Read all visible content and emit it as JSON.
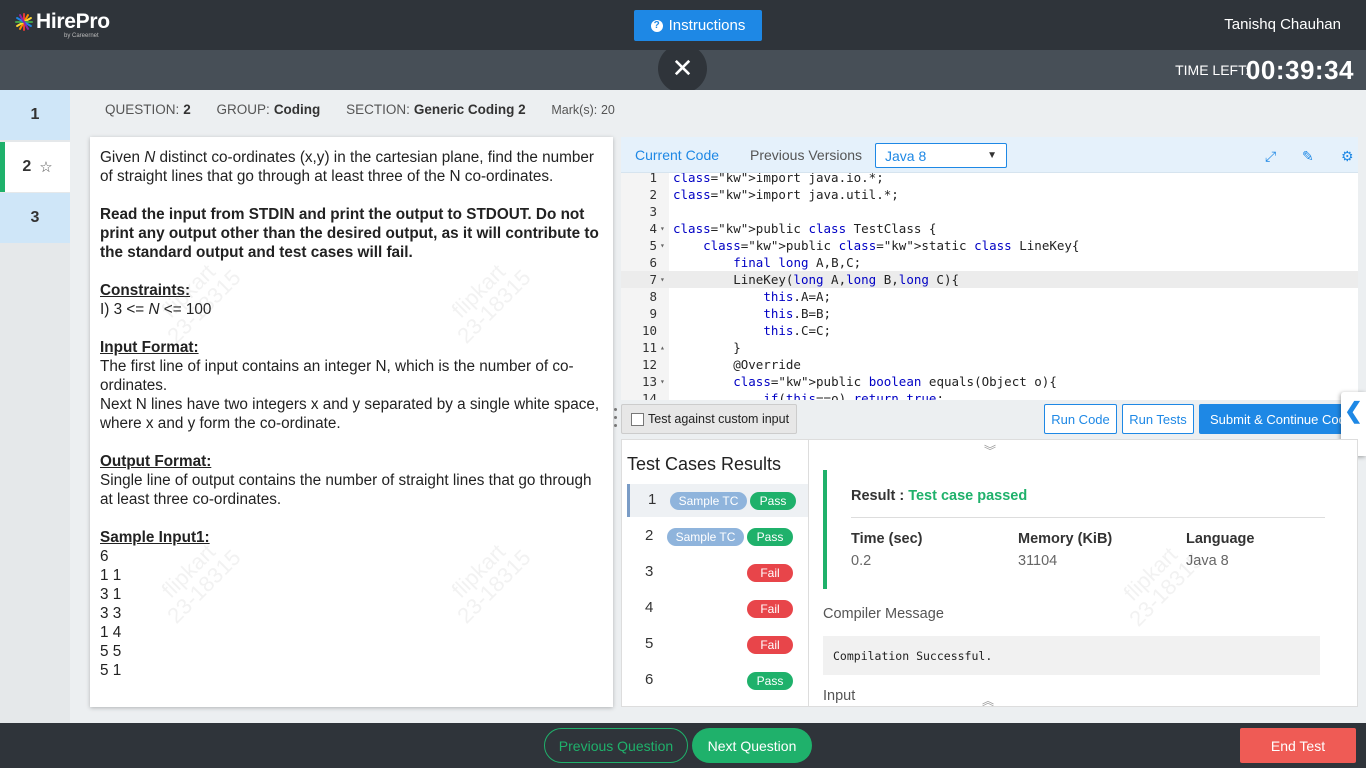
{
  "header": {
    "logo_text": "HirePro",
    "logo_sub": "by Careernet",
    "instructions_label": "Instructions",
    "user_name": "Tanishq Chauhan",
    "time_left_label": "TIME LEFT:",
    "time_left_value": "00:39:34"
  },
  "question_nav": [
    {
      "num": "1"
    },
    {
      "num": "2"
    },
    {
      "num": "3"
    }
  ],
  "meta": {
    "question_label": "QUESTION:",
    "question_value": "2",
    "group_label": "GROUP:",
    "group_value": "Coding",
    "section_label": "SECTION:",
    "section_value": "Generic Coding 2",
    "marks_label": "Mark(s):",
    "marks_value": "20"
  },
  "problem": {
    "intro_a": "Given ",
    "intro_n": "N",
    "intro_b": " distinct co-ordinates (x,y) in the cartesian plane, find the number of straight lines that go through at least three of the N co-ordinates.",
    "stdin_note": "Read the input from STDIN and print the output to STDOUT. Do not print any output other than the desired output, as it will contribute to the standard output and test cases will fail.",
    "constraints_heading": "Constraints:",
    "constraint_a": "I) 3 <= ",
    "constraint_n": "N",
    "constraint_b": " <= 100",
    "input_heading": "Input Format:",
    "input_line1": "The first line of input contains an integer N, which is the number of co-ordinates.",
    "input_line2": "Next N lines have two integers x and y separated by a single white space, where x and y form the co-ordinate.",
    "output_heading": "Output Format:",
    "output_line1": "Single line of output contains the number of straight lines that go through at least three co-ordinates.",
    "sample_heading": "Sample Input1:",
    "sample_lines": [
      "6",
      "1 1",
      "3 1",
      "3 3",
      "1 4",
      "5 5",
      "5 1"
    ]
  },
  "editor": {
    "tab_current": "Current Code",
    "tab_previous": "Previous Versions",
    "language": "Java 8",
    "code_lines": [
      {
        "n": "1",
        "fold": "",
        "text": "import java.io.*;"
      },
      {
        "n": "2",
        "fold": "",
        "text": "import java.util.*;"
      },
      {
        "n": "3",
        "fold": "",
        "text": ""
      },
      {
        "n": "4",
        "fold": "▾",
        "text": "public class TestClass {"
      },
      {
        "n": "5",
        "fold": "▾",
        "text": "    public static class LineKey{"
      },
      {
        "n": "6",
        "fold": "",
        "text": "        final long A,B,C;"
      },
      {
        "n": "7",
        "fold": "▾",
        "text": "        LineKey(long A,long B,long C){"
      },
      {
        "n": "8",
        "fold": "",
        "text": "            this.A=A;"
      },
      {
        "n": "9",
        "fold": "",
        "text": "            this.B=B;"
      },
      {
        "n": "10",
        "fold": "",
        "text": "            this.C=C;"
      },
      {
        "n": "11",
        "fold": "▴",
        "text": "        }"
      },
      {
        "n": "12",
        "fold": "",
        "text": "        @Override"
      },
      {
        "n": "13",
        "fold": "▾",
        "text": "        public boolean equals(Object o){"
      },
      {
        "n": "14",
        "fold": "",
        "text": "            if(this==o) return true;"
      }
    ]
  },
  "controls": {
    "custom_input_label": "Test against custom input",
    "run_code": "Run Code",
    "run_tests": "Run Tests",
    "submit": "Submit & Continue Coding"
  },
  "results": {
    "title": "Test Cases Results",
    "cases": [
      {
        "num": "1",
        "sample": "Sample TC",
        "status": "Pass"
      },
      {
        "num": "2",
        "sample": "Sample TC",
        "status": "Pass"
      },
      {
        "num": "3",
        "sample": "",
        "status": "Fail"
      },
      {
        "num": "4",
        "sample": "",
        "status": "Fail"
      },
      {
        "num": "5",
        "sample": "",
        "status": "Fail"
      },
      {
        "num": "6",
        "sample": "",
        "status": "Pass"
      }
    ],
    "result_label": "Result :",
    "result_value": "Test case passed",
    "time_label": "Time (sec)",
    "time_value": "0.2",
    "memory_label": "Memory (KiB)",
    "memory_value": "31104",
    "language_label": "Language",
    "language_value": "Java 8",
    "compiler_label": "Compiler Message",
    "compiler_value": "Compilation Successful.",
    "input_label": "Input"
  },
  "footer": {
    "previous_question": "Previous Question",
    "next_question": "Next Question",
    "end_test": "End Test"
  },
  "watermark": "flipkart\n23-18315",
  "colors": {
    "accent_blue": "#1e88e5",
    "success_green": "#1fb16b",
    "fail_red": "#e8454a",
    "end_red": "#ef5b55",
    "topbar": "#2f343a"
  }
}
